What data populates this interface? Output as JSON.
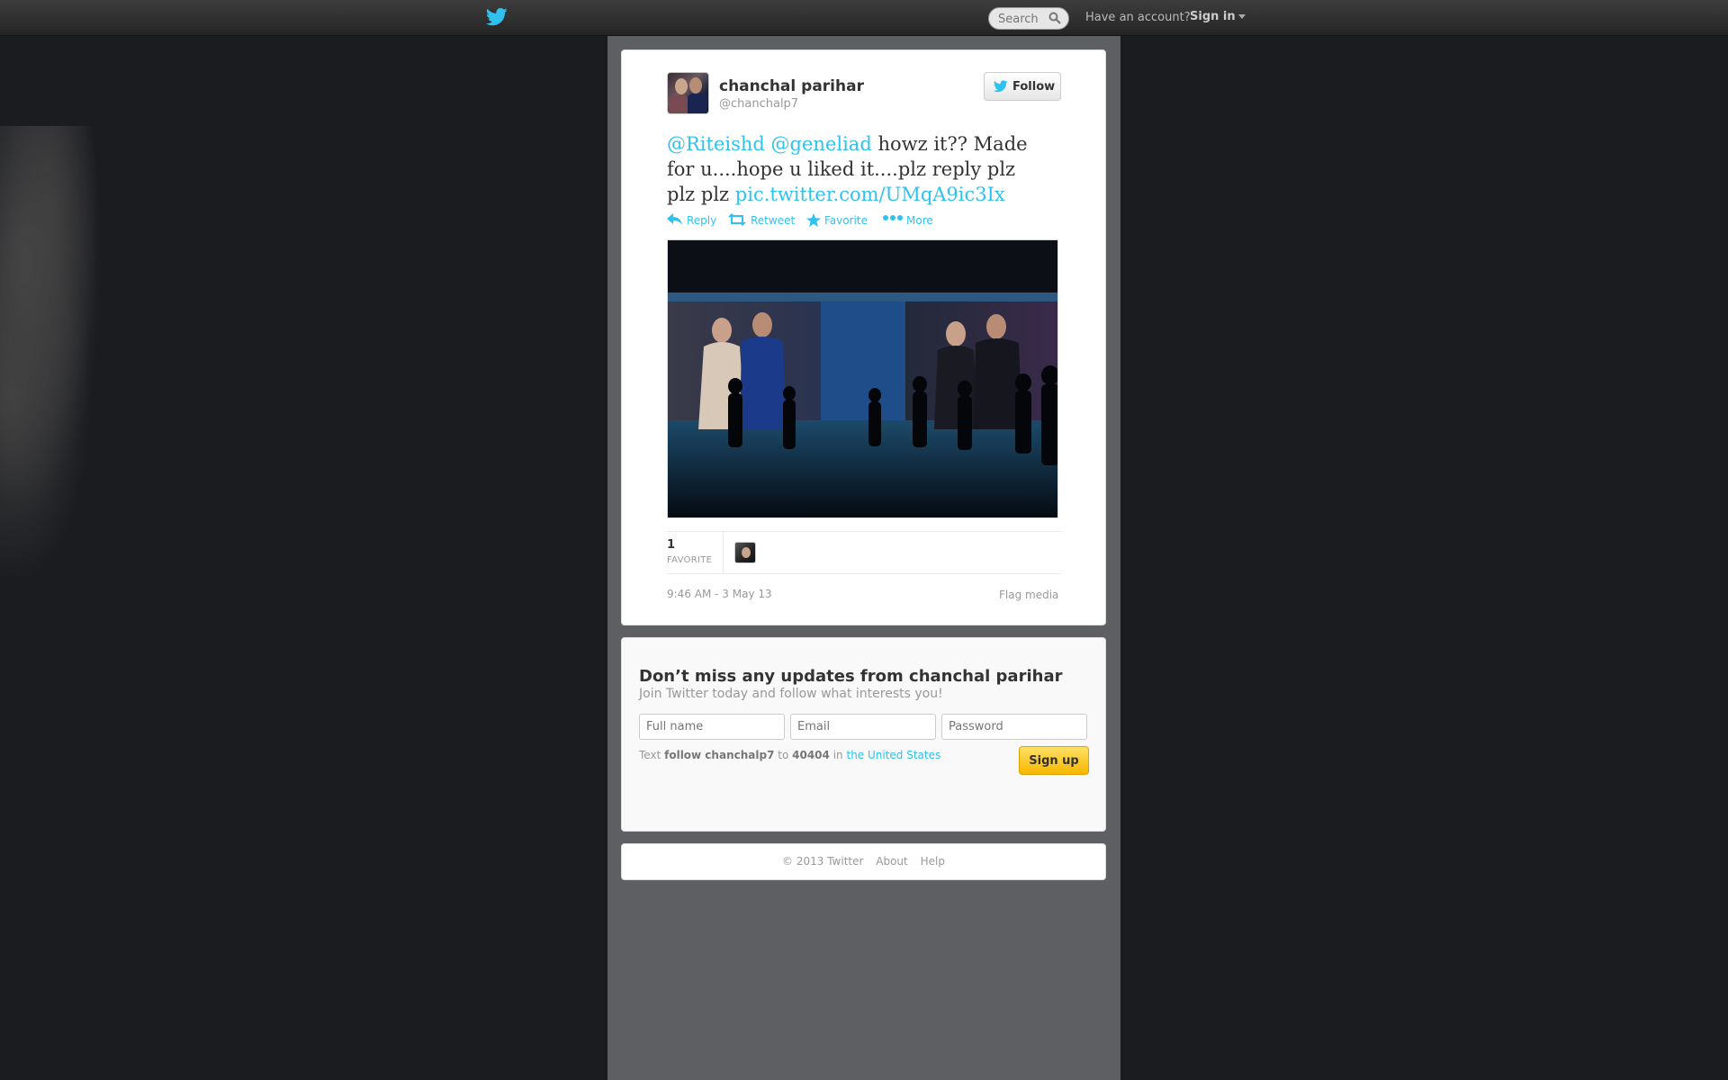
{
  "topbar": {
    "logo_icon": "twitter-bird-icon",
    "search_placeholder": "Search",
    "have_account": "Have an account?",
    "sign_in": "Sign in"
  },
  "tweet": {
    "fullname": "chanchal parihar",
    "username": "@chanchalp7",
    "follow_label": "Follow",
    "mention1": "@Riteishd",
    "mention2": "@geneliad",
    "text": " howz it?? Made for u....hope u liked it....plz reply plz plz plz ",
    "pic_link": "pic.twitter.com/UMqA9ic3Ix",
    "actions": {
      "reply": "Reply",
      "retweet": "Retweet",
      "favorite": "Favorite",
      "more": "More"
    },
    "favorite_count": "1",
    "favorite_label": "FAVORITE",
    "timestamp": "9:46 AM - 3 May 13",
    "flag_media": "Flag media"
  },
  "signup": {
    "title": "Don’t miss any updates from chanchal parihar",
    "subtitle": "Join Twitter today and follow what interests you!",
    "fullname_placeholder": "Full name",
    "email_placeholder": "Email",
    "password_placeholder": "Password",
    "sms_text": "Text",
    "sms_command": "follow chanchalp7",
    "sms_to": "to",
    "sms_number": "40404",
    "sms_in": "in",
    "sms_country": "the United States",
    "signup_label": "Sign up"
  },
  "footer": {
    "copyright": "© 2013 Twitter",
    "about": "About",
    "help": "Help"
  },
  "colors": {
    "link": "#2fc2ef",
    "page_bg": "#1b1c20",
    "column_bg": "#5e5f63",
    "signup_button": "#f7b800"
  }
}
